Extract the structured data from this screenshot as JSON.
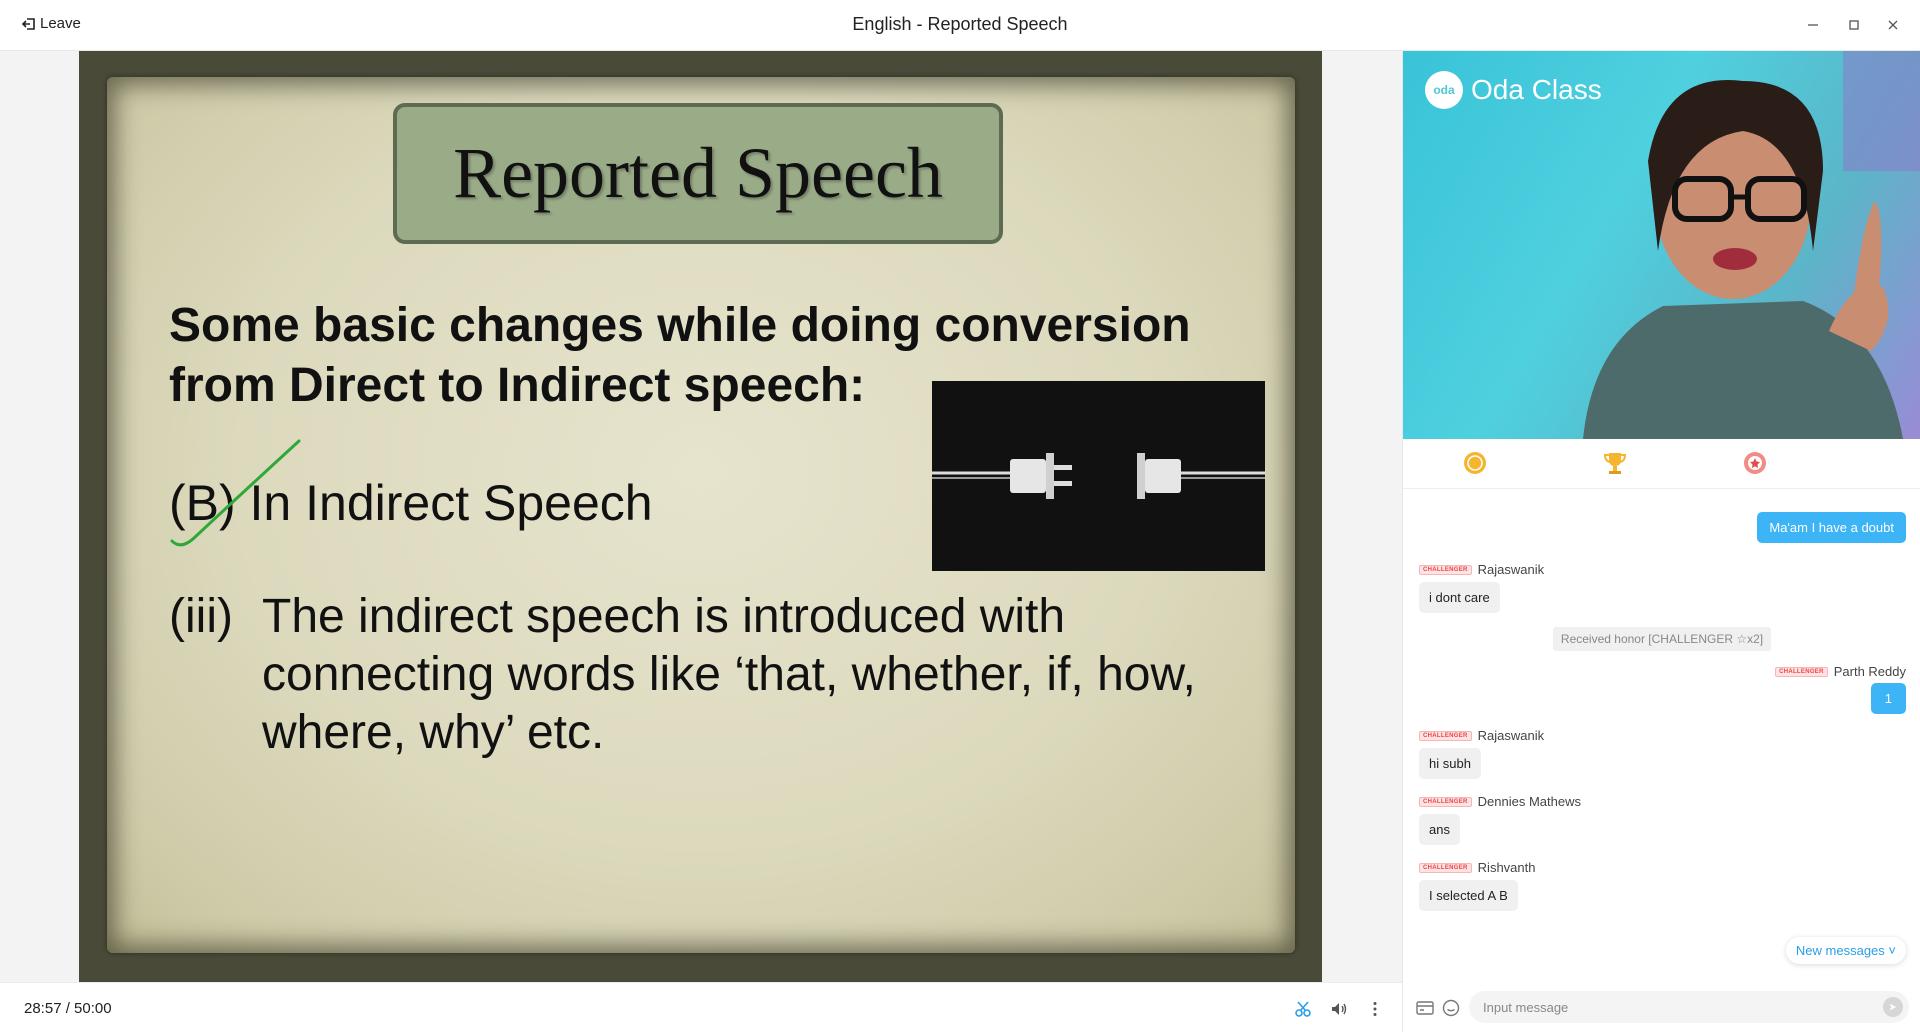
{
  "titlebar": {
    "leave_label": "Leave",
    "title": "English - Reported Speech"
  },
  "slide": {
    "title": "Reported Speech",
    "heading": "Some basic changes while doing conversion from Direct to Indirect speech:",
    "point_b": "(B) In Indirect Speech",
    "point_iii_num": "(iii)",
    "point_iii_text": "The indirect speech is introduced with connecting words like ‘that, whether, if, how, where, why’ etc."
  },
  "bottombar": {
    "time": "28:57  / 50:00"
  },
  "video": {
    "brand": "Oda Class",
    "logo_text": "oda"
  },
  "chat": {
    "doubt_button": "Ma'am I have a doubt",
    "badge_label": "CHALLENGER",
    "messages": [
      {
        "name": "Rajaswanik",
        "text": "i dont care"
      },
      {
        "system": "Received honor [CHALLENGER ☆x2]"
      },
      {
        "name": "Parth Reddy",
        "text": "1"
      },
      {
        "name": "Rajaswanik",
        "text": "hi subh"
      },
      {
        "name": "Dennies Mathews",
        "text": "ans"
      },
      {
        "name": "Rishvanth",
        "text": "I selected A B"
      }
    ],
    "new_messages": "New messages ˅",
    "input_placeholder": "Input message"
  },
  "colors": {
    "accent": "#3db4f5",
    "badge": "#e44444",
    "title_box": "#9aab88"
  }
}
